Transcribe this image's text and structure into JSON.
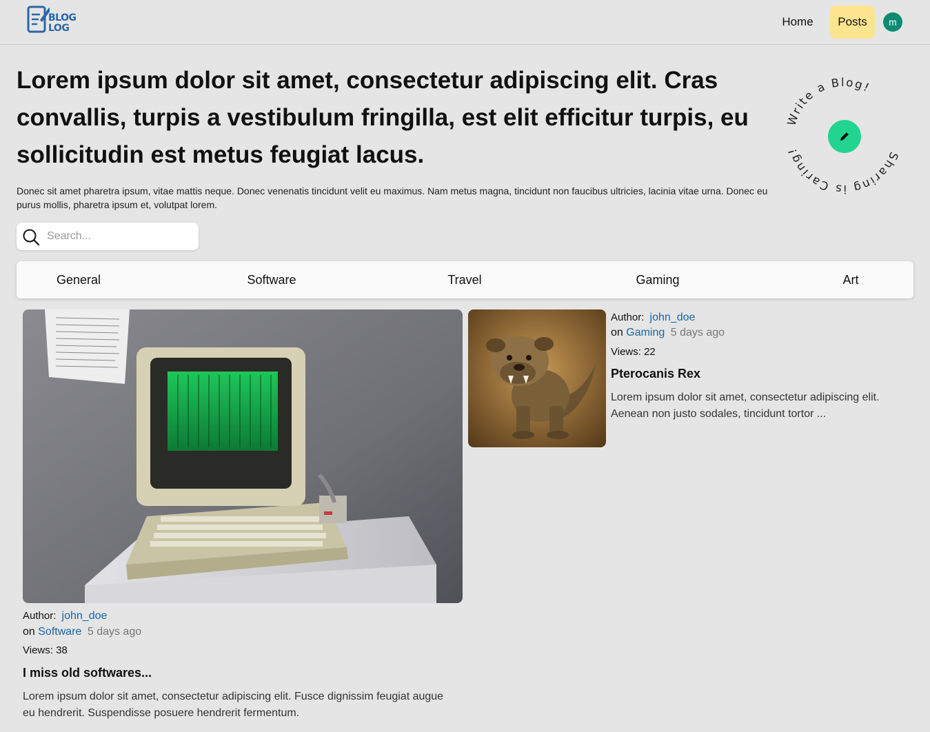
{
  "nav": {
    "logo_line1": "BLOG",
    "logo_line2": "LOG",
    "home_label": "Home",
    "posts_label": "Posts",
    "avatar_initial": "m"
  },
  "hero": {
    "title": "Lorem ipsum dolor sit amet, consectetur adipiscing elit. Cras convallis, turpis a vestibulum fringilla, est elit efficitur turpis, eu sollicitudin est metus feugiat lacus.",
    "subtitle": "Donec sit amet pharetra ipsum, vitae mattis neque. Donec venenatis tincidunt velit eu maximus. Nam metus magna, tincidunt non faucibus ultricies, lacinia vitae urna. Donec eu purus mollis, pharetra ipsum et, volutpat lorem."
  },
  "badge": {
    "top_text": "Write a Blog!",
    "bottom_text": "Sharing is Caring!"
  },
  "search": {
    "placeholder": "Search..."
  },
  "categories": [
    "General",
    "Software",
    "Travel",
    "Gaming",
    "Art"
  ],
  "posts": [
    {
      "author_label": "Author:",
      "author": "john_doe",
      "on_label": "on",
      "category": "Software",
      "time": "5 days ago",
      "views": "Views: 38",
      "title": "I miss old softwares...",
      "excerpt": "Lorem ipsum dolor sit amet, consectetur adipiscing elit. Fusce dignissim feugiat augue eu hendrerit. Suspendisse posuere hendrerit fermentum.",
      "image": "vintage-computer-photo"
    },
    {
      "author_label": "Author:",
      "author": "john_doe",
      "on_label": "on",
      "category": "Gaming",
      "time": "5 days ago",
      "views": "Views: 22",
      "title": "Pterocanis Rex",
      "excerpt": "Lorem ipsum dolor sit amet, consectetur adipiscing elit. Aenean non justo sodales, tincidunt tortor ...",
      "image": "bulldog-dinosaur-painting"
    }
  ],
  "colors": {
    "accent_green": "#21d48f",
    "avatar_teal": "#0f8a72",
    "posts_highlight": "#fde48f",
    "link_blue": "#1766a8"
  }
}
